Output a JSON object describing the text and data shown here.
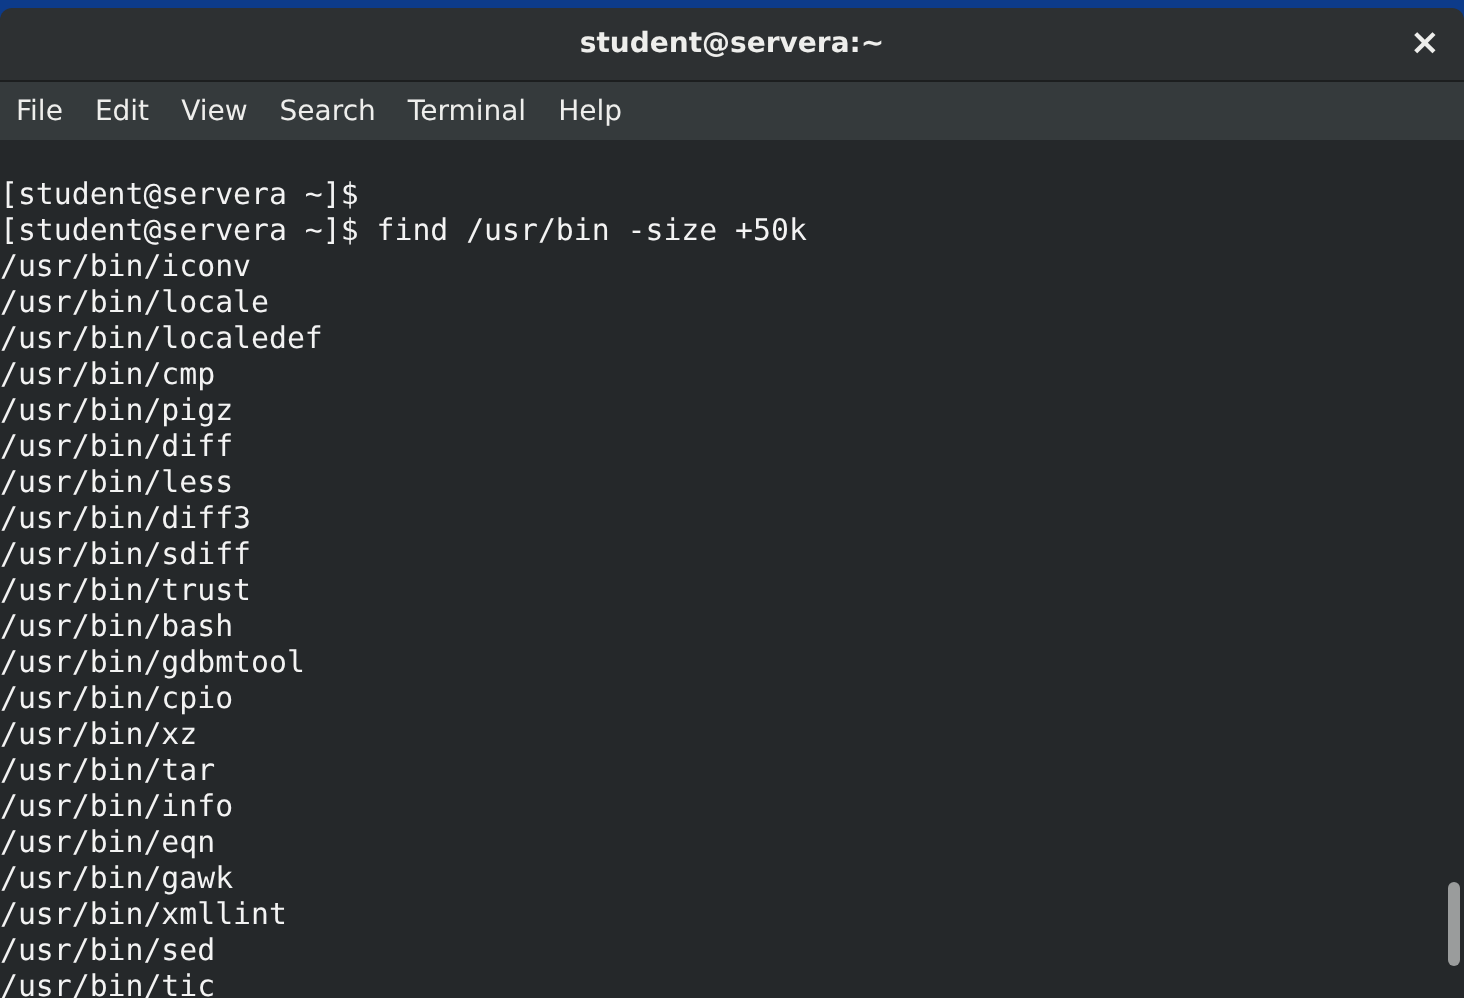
{
  "window": {
    "title": "student@servera:~",
    "close": "×"
  },
  "menu": [
    "File",
    "Edit",
    "View",
    "Search",
    "Terminal",
    "Help"
  ],
  "terminal": {
    "lines": [
      "[student@servera ~]$",
      "[student@servera ~]$ find /usr/bin -size +50k",
      "/usr/bin/iconv",
      "/usr/bin/locale",
      "/usr/bin/localedef",
      "/usr/bin/cmp",
      "/usr/bin/pigz",
      "/usr/bin/diff",
      "/usr/bin/less",
      "/usr/bin/diff3",
      "/usr/bin/sdiff",
      "/usr/bin/trust",
      "/usr/bin/bash",
      "/usr/bin/gdbmtool",
      "/usr/bin/cpio",
      "/usr/bin/xz",
      "/usr/bin/tar",
      "/usr/bin/info",
      "/usr/bin/eqn",
      "/usr/bin/gawk",
      "/usr/bin/xmllint",
      "/usr/bin/sed",
      "/usr/bin/tic"
    ]
  }
}
